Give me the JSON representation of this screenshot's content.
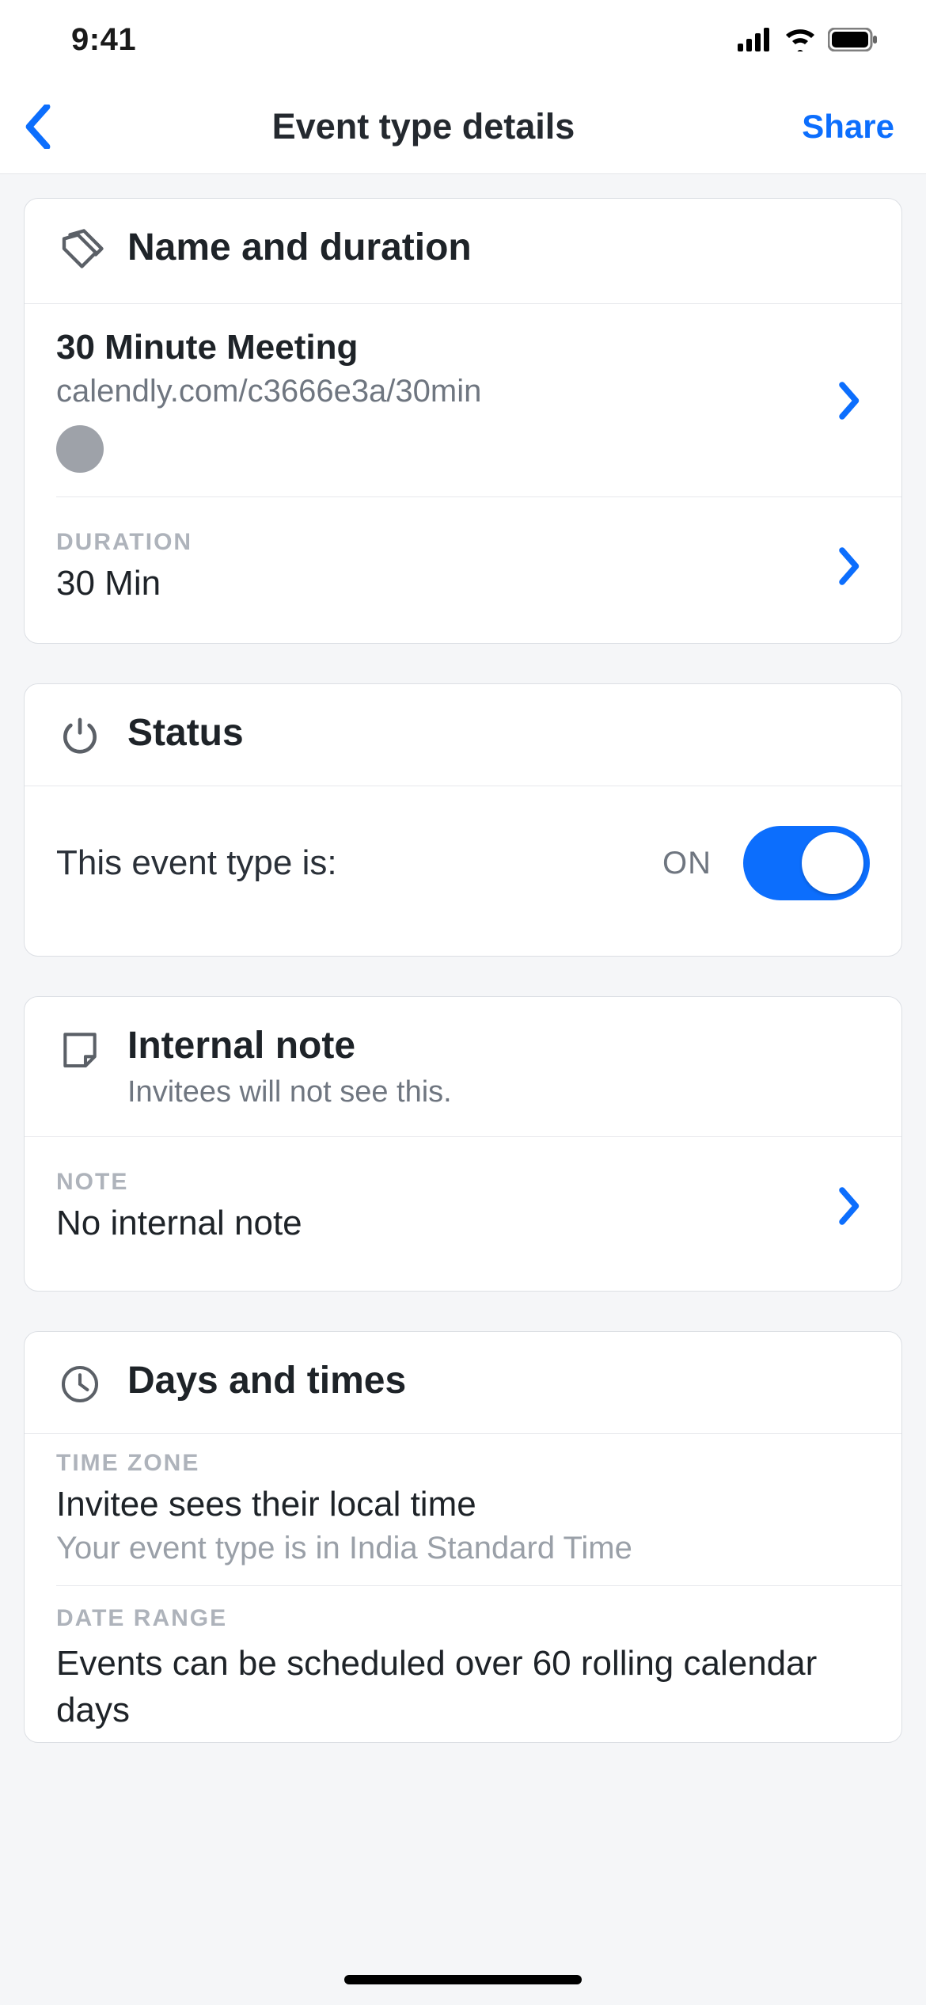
{
  "statusbar": {
    "time": "9:41"
  },
  "nav": {
    "title": "Event type details",
    "share_label": "Share"
  },
  "sections": {
    "name_duration": {
      "title": "Name and duration",
      "event_name": "30 Minute Meeting",
      "event_url": "calendly.com/c3666e3a/30min",
      "color_hex": "#9ea2a9",
      "duration_label": "DURATION",
      "duration_value": "30 Min"
    },
    "status": {
      "title": "Status",
      "prompt": "This event type is:",
      "state_label": "ON",
      "enabled": true
    },
    "internal_note": {
      "title": "Internal note",
      "subtitle": "Invitees will not see this.",
      "note_label": "NOTE",
      "note_value": "No internal note"
    },
    "days_times": {
      "title": "Days and times",
      "timezone_label": "TIME ZONE",
      "timezone_value": "Invitee sees their local time",
      "timezone_note": "Your event type is in India Standard Time",
      "date_range_label": "DATE RANGE",
      "date_range_value": "Events can be scheduled over 60 rolling calendar days"
    }
  }
}
